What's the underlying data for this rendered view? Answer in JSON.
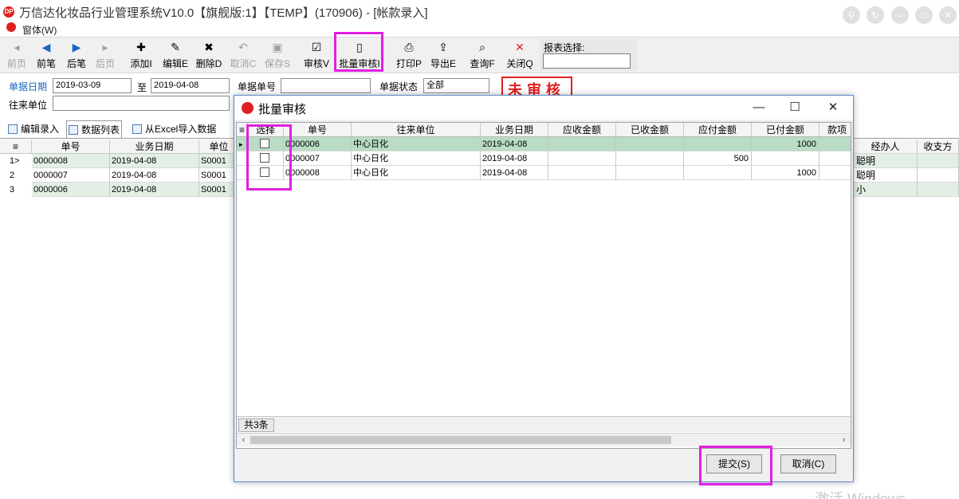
{
  "titlebar": {
    "title": "万信达化妆品行业管理系统V10.0【旗舰版:1】【TEMP】(170906) - [帐款录入]",
    "menu_window": "窗体(W)"
  },
  "toolbar": {
    "buttons": [
      {
        "label": "前页",
        "icon": "◂"
      },
      {
        "label": "前笔",
        "icon": "◀"
      },
      {
        "label": "后笔",
        "icon": "▶"
      },
      {
        "label": "后页",
        "icon": "▸"
      },
      {
        "label": "添加I",
        "icon": "✚"
      },
      {
        "label": "编辑E",
        "icon": "✎"
      },
      {
        "label": "删除D",
        "icon": "✖"
      },
      {
        "label": "取消C",
        "icon": "↶"
      },
      {
        "label": "保存S",
        "icon": "▣"
      },
      {
        "label": "审核V",
        "icon": "☑"
      },
      {
        "label": "批量审核I",
        "icon": "▯"
      },
      {
        "label": "打印P",
        "icon": "⎙"
      },
      {
        "label": "导出E",
        "icon": "⇪"
      },
      {
        "label": "查询F",
        "icon": "⌕"
      },
      {
        "label": "关闭Q",
        "icon": "✕"
      }
    ],
    "report_label": "报表选择:",
    "report_value": ""
  },
  "filters": {
    "date_label": "单据日期",
    "date_from": "2019-03-09",
    "to_label": "至",
    "date_to": "2019-04-08",
    "doc_no_label": "单据单号",
    "doc_no_value": "",
    "status_label": "单据状态",
    "status_value": "全部",
    "partner_label": "往来单位",
    "partner_value": "",
    "stamp": "未审核"
  },
  "main_tabs": [
    "编辑录入",
    "数据列表",
    "从Excel导入数据"
  ],
  "bg_grid": {
    "headers": [
      "单号",
      "业务日期",
      "单位"
    ],
    "rows": [
      {
        "num": "1>",
        "no": "0000008",
        "date": "2019-04-08",
        "unit": "S0001"
      },
      {
        "num": "2",
        "no": "0000007",
        "date": "2019-04-08",
        "unit": "S0001"
      },
      {
        "num": "3",
        "no": "0000006",
        "date": "2019-04-08",
        "unit": "S0001"
      }
    ]
  },
  "right_grid": {
    "headers": [
      "经办人",
      "收支方"
    ],
    "rows": [
      [
        "聪明",
        ""
      ],
      [
        "聪明",
        ""
      ],
      [
        "小",
        ""
      ]
    ]
  },
  "dialog": {
    "title": "批量审核",
    "headers": [
      "选择",
      "单号",
      "往来单位",
      "业务日期",
      "应收金额",
      "已收金额",
      "应付金额",
      "已付金额",
      "款项"
    ],
    "rows": [
      {
        "checked": false,
        "no": "0000006",
        "unit": "中心日化",
        "date": "2019-04-08",
        "ar": "",
        "received": "",
        "ap": "",
        "paid": "1000"
      },
      {
        "checked": false,
        "no": "0000007",
        "unit": "中心日化",
        "date": "2019-04-08",
        "ar": "",
        "received": "",
        "ap": "500",
        "paid": ""
      },
      {
        "checked": false,
        "no": "0000008",
        "unit": "中心日化",
        "date": "2019-04-08",
        "ar": "",
        "received": "",
        "ap": "",
        "paid": "1000"
      }
    ],
    "footer_count": "共3条",
    "submit_label": "提交(S)",
    "cancel_label": "取消(C)"
  },
  "watermark": "激活 Windows",
  "colors": {
    "accent_blue": "#1a66c0",
    "highlight_magenta": "#e020e0",
    "selected_row_green": "#b8dcc4",
    "row_green": "#e3efe5",
    "stamp_red": "#e02020"
  }
}
